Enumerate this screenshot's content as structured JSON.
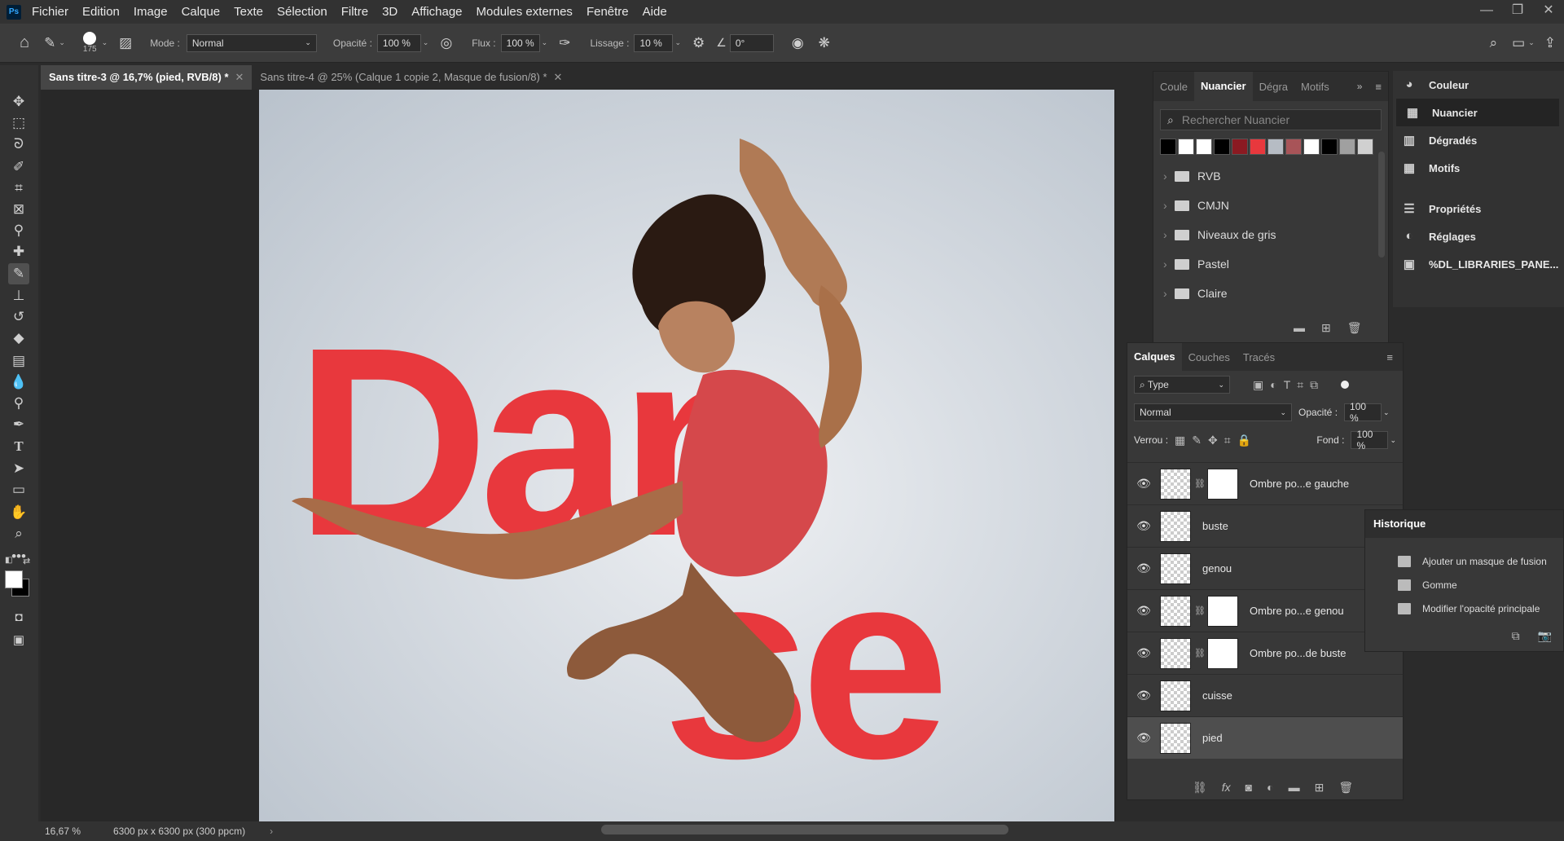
{
  "app": {
    "logo": "Ps"
  },
  "menu": [
    "Fichier",
    "Edition",
    "Image",
    "Calque",
    "Texte",
    "Sélection",
    "Filtre",
    "3D",
    "Affichage",
    "Modules externes",
    "Fenêtre",
    "Aide"
  ],
  "options": {
    "brush_size": "175",
    "mode_label": "Mode :",
    "mode_value": "Normal",
    "opacity_label": "Opacité :",
    "opacity_value": "100 %",
    "flux_label": "Flux :",
    "flux_value": "100 %",
    "lissage_label": "Lissage :",
    "lissage_value": "10 %",
    "angle_value": "0°"
  },
  "tabs": [
    {
      "label": "Sans titre-3 @ 16,7% (pied, RVB/8) *",
      "active": true
    },
    {
      "label": "Sans titre-4 @ 25% (Calque 1 copie 2, Masque de fusion/8) *",
      "active": false
    }
  ],
  "canvas": {
    "text_top": "Dan",
    "text_bottom": "se",
    "text_color": "#e8383d"
  },
  "status": {
    "zoom": "16,67 %",
    "doc_info": "6300 px x 6300 px (300 ppcm)"
  },
  "nuancier": {
    "tabs": [
      "Coule",
      "Nuancier",
      "Dégra",
      "Motifs"
    ],
    "active_tab": "Nuancier",
    "search_placeholder": "Rechercher Nuancier",
    "swatches": [
      "#000000",
      "#ffffff",
      "#ffffff",
      "#000000",
      "#8b1a22",
      "#e8383d",
      "#b6bcc4",
      "#a85458",
      "#ffffff",
      "#000000",
      "#a0a0a0",
      "#d0d0d0"
    ],
    "folders": [
      "RVB",
      "CMJN",
      "Niveaux de gris",
      "Pastel",
      "Claire"
    ]
  },
  "dock": {
    "items": [
      "Couleur",
      "Nuancier",
      "Dégradés",
      "Motifs",
      "Propriétés",
      "Réglages",
      "%DL_LIBRARIES_PANE..."
    ],
    "active": "Nuancier"
  },
  "layers_panel": {
    "tabs": [
      "Calques",
      "Couches",
      "Tracés"
    ],
    "filter_value": "Type",
    "blend_value": "Normal",
    "opacity_label": "Opacité :",
    "opacity_value": "100 %",
    "lock_label": "Verrou :",
    "fill_label": "Fond :",
    "fill_value": "100 %",
    "layers": [
      {
        "name": "Ombre po...e gauche",
        "mask": true
      },
      {
        "name": "buste",
        "mask": false
      },
      {
        "name": "genou",
        "mask": false
      },
      {
        "name": "Ombre po...e genou",
        "mask": true
      },
      {
        "name": "Ombre po...de buste",
        "mask": true
      },
      {
        "name": "cuisse",
        "mask": false
      },
      {
        "name": "pied",
        "mask": false,
        "selected": true
      }
    ]
  },
  "history": {
    "title": "Historique",
    "items": [
      "Ajouter un masque de fusion",
      "Gomme",
      "Modifier l'opacité principale"
    ]
  }
}
